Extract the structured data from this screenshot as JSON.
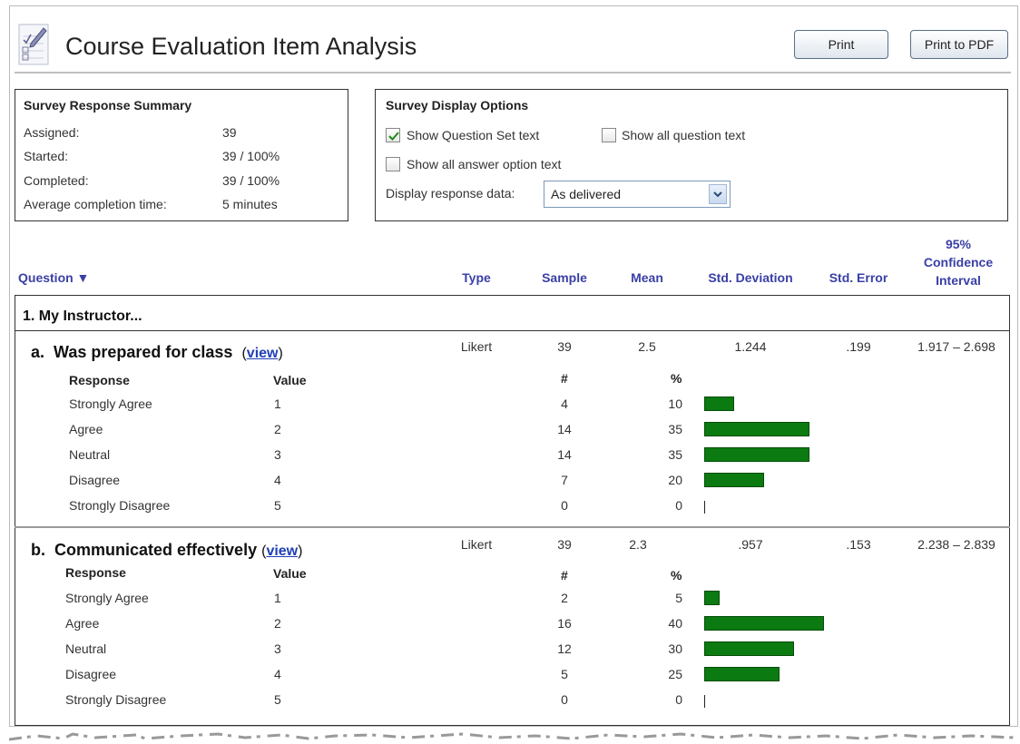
{
  "page": {
    "title": "Course Evaluation Item Analysis"
  },
  "toolbar": {
    "print_label": "Print",
    "print_pdf_label": "Print to PDF"
  },
  "summary": {
    "title": "Survey Response Summary",
    "rows": [
      {
        "label": "Assigned:",
        "value": "39"
      },
      {
        "label": "Started:",
        "value": "39 / 100%"
      },
      {
        "label": "Completed:",
        "value": "39 / 100%"
      },
      {
        "label": "Average completion time:",
        "value": "5 minutes"
      }
    ]
  },
  "options": {
    "title": "Survey Display Options",
    "show_question_set": {
      "label": "Show Question Set text",
      "checked": true
    },
    "show_all_question": {
      "label": "Show all question text",
      "checked": false
    },
    "show_all_answer": {
      "label": "Show all answer option text",
      "checked": false
    },
    "display_label": "Display response data:",
    "display_value": "As delivered"
  },
  "columns": {
    "question": "Question ▼",
    "type": "Type",
    "sample": "Sample",
    "mean": "Mean",
    "std_dev": "Std. Deviation",
    "std_err": "Std. Error",
    "ci": "95% Confidence Interval",
    "ci_line1": "95%",
    "ci_line2": "Confidence",
    "ci_line3": "Interval"
  },
  "question_set": {
    "label": "1.  My Instructor..."
  },
  "response_headers": {
    "response": "Response",
    "value": "Value",
    "count": "#",
    "percent": "%"
  },
  "items": [
    {
      "prefix": "a.",
      "title": "Was prepared for class",
      "view_label": "view",
      "type": "Likert",
      "sample": "39",
      "mean": "2.5",
      "std_dev": "1.244",
      "std_err": ".199",
      "ci": "1.917 – 2.698",
      "responses": [
        {
          "label": "Strongly Agree",
          "value": "1",
          "count": "4",
          "percent": "10",
          "pct_num": 10
        },
        {
          "label": "Agree",
          "value": "2",
          "count": "14",
          "percent": "35",
          "pct_num": 35
        },
        {
          "label": "Neutral",
          "value": "3",
          "count": "14",
          "percent": "35",
          "pct_num": 35
        },
        {
          "label": "Disagree",
          "value": "4",
          "count": "7",
          "percent": "20",
          "pct_num": 20
        },
        {
          "label": "Strongly Disagree",
          "value": "5",
          "count": "0",
          "percent": "0",
          "pct_num": 0
        }
      ]
    },
    {
      "prefix": "b.",
      "title": "Communicated effectively",
      "view_label": "view",
      "type": "Likert",
      "sample": "39",
      "mean": "2.3",
      "std_dev": ".957",
      "std_err": ".153",
      "ci": "2.238 – 2.839",
      "responses": [
        {
          "label": "Strongly Agree",
          "value": "1",
          "count": "2",
          "percent": "5",
          "pct_num": 5
        },
        {
          "label": "Agree",
          "value": "2",
          "count": "16",
          "percent": "40",
          "pct_num": 40
        },
        {
          "label": "Neutral",
          "value": "3",
          "count": "12",
          "percent": "30",
          "pct_num": 30
        },
        {
          "label": "Disagree",
          "value": "4",
          "count": "5",
          "percent": "25",
          "pct_num": 25
        },
        {
          "label": "Strongly Disagree",
          "value": "5",
          "count": "0",
          "percent": "0",
          "pct_num": 0
        }
      ]
    }
  ],
  "colors": {
    "bar": "#0b7a11",
    "header_link": "#3a3fa6",
    "view_link": "#1f3fb5"
  }
}
